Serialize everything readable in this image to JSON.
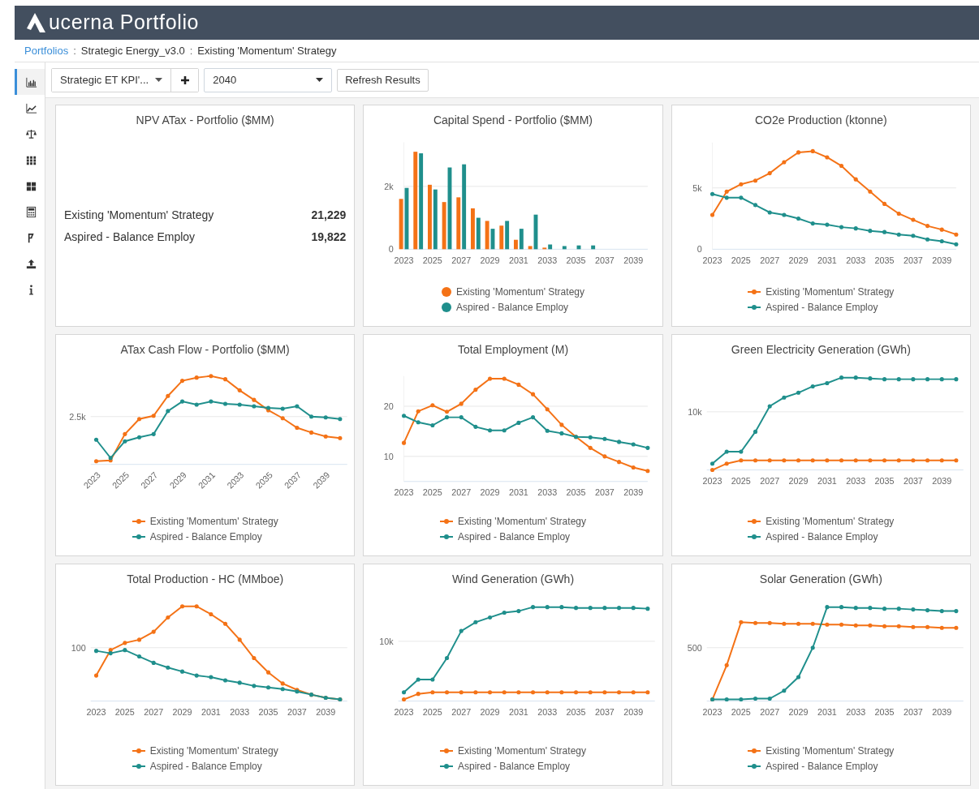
{
  "header": {
    "title": "ucerna Portfolio"
  },
  "breadcrumb": [
    {
      "label": "Portfolios",
      "kind": "link"
    },
    {
      "label": ":",
      "kind": "separator"
    },
    {
      "label": "Strategic Energy_v3.0",
      "kind": "text"
    },
    {
      "label": ":",
      "kind": "separator"
    },
    {
      "label": "Existing 'Momentum' Strategy",
      "kind": "text"
    }
  ],
  "sidebar": {
    "items": [
      {
        "selected": true
      },
      {
        "selected": false
      },
      {
        "selected": false
      },
      {
        "selected": false
      },
      {
        "selected": false
      },
      {
        "selected": false
      },
      {
        "selected": false
      },
      {
        "selected": false
      },
      {
        "selected": false
      }
    ]
  },
  "toolbar": {
    "view_select": {
      "value": "Strategic ET KPI'..."
    },
    "year_select": {
      "value": "2040"
    },
    "refresh_button": {
      "label": "Refresh Results"
    }
  },
  "cards": [
    {
      "kind": "kpi",
      "title": "NPV ATax - Portfolio ($MM)",
      "rows": [
        {
          "label": "Existing 'Momentum' Strategy",
          "value": "21,229"
        },
        {
          "label": "Aspired - Balance Employ",
          "value": "19,822"
        }
      ]
    },
    {
      "kind": "chart",
      "title": "Capital Spend - Portfolio ($MM)",
      "chart_data": {
        "type": "bar",
        "x": [
          2023,
          2024,
          2025,
          2026,
          2027,
          2028,
          2029,
          2030,
          2031,
          2032,
          2033,
          2034,
          2035,
          2036,
          2037,
          2038,
          2039,
          2040
        ],
        "xticks": [
          2023,
          2025,
          2027,
          2029,
          2031,
          2033,
          2035,
          2037,
          2039
        ],
        "yticks": [
          0,
          {
            "value": 2000,
            "label": "2k"
          }
        ],
        "xlim": [
          2023,
          2040
        ],
        "ylim": [
          0,
          3400
        ],
        "series": [
          {
            "name": "Existing 'Momentum' Strategy",
            "color": "#f47216",
            "values": [
              1600,
              3100,
              2050,
              1500,
              1650,
              1300,
              900,
              750,
              300,
              100,
              50,
              0,
              0,
              0,
              0,
              0,
              0,
              0
            ]
          },
          {
            "name": "Aspired - Balance Employ",
            "color": "#1f8f8c",
            "values": [
              1950,
              3050,
              1900,
              2600,
              2700,
              1000,
              650,
              900,
              650,
              1100,
              150,
              100,
              120,
              120,
              0,
              0,
              0,
              0
            ]
          }
        ]
      }
    },
    {
      "kind": "chart",
      "title": "CO2e Production (ktonne)",
      "chart_data": {
        "type": "line",
        "x": [
          2023,
          2024,
          2025,
          2026,
          2027,
          2028,
          2029,
          2030,
          2031,
          2032,
          2033,
          2034,
          2035,
          2036,
          2037,
          2038,
          2039,
          2040
        ],
        "xticks": [
          2023,
          2025,
          2027,
          2029,
          2031,
          2033,
          2035,
          2037,
          2039
        ],
        "yticks": [
          0,
          {
            "value": 5000,
            "label": "5k"
          }
        ],
        "xlim": [
          2023,
          2040
        ],
        "ylim": [
          0,
          8700
        ],
        "series": [
          {
            "name": "Existing 'Momentum' Strategy",
            "color": "#f47216",
            "values": [
              2800,
              4700,
              5300,
              5600,
              6200,
              7100,
              7900,
              8000,
              7500,
              6800,
              5700,
              4700,
              3700,
              2900,
              2400,
              1900,
              1600,
              1200
            ]
          },
          {
            "name": "Aspired - Balance Employ",
            "color": "#1f8f8c",
            "values": [
              4500,
              4200,
              4200,
              3600,
              3000,
              2800,
              2500,
              2100,
              2000,
              1800,
              1700,
              1500,
              1400,
              1200,
              1100,
              800,
              650,
              400
            ]
          }
        ]
      }
    },
    {
      "kind": "line_picture",
      "title": "ATax Cash Flow - Portfolio ($MM)",
      "y_tick": "2.5k",
      "x_labels_rotated": true,
      "x_labels": [
        "2023",
        "2025",
        "2027",
        "2029",
        "2031",
        "2033",
        "2035",
        "2037",
        "2039"
      ],
      "legend": [
        {
          "label": "Existing 'Momentum' Strategy",
          "color": "#f47216"
        },
        {
          "label": "Aspired - Balance Employ",
          "color": "#1f8f8c"
        }
      ]
    },
    {
      "kind": "chart",
      "title": "Total Employment (M)",
      "chart_data": {
        "type": "line",
        "x": [
          2023,
          2024,
          2025,
          2026,
          2027,
          2028,
          2029,
          2030,
          2031,
          2032,
          2033,
          2034,
          2035,
          2036,
          2037,
          2038,
          2039,
          2040
        ],
        "xticks": [
          2023,
          2025,
          2027,
          2029,
          2031,
          2033,
          2035,
          2037,
          2039
        ],
        "yticks": [
          10,
          20
        ],
        "xlim": [
          2023,
          2040
        ],
        "ylim": [
          5,
          26
        ],
        "series": [
          {
            "name": "Existing 'Momentum' Strategy",
            "color": "#f47216",
            "values": [
              12.7,
              19.0,
              20.2,
              18.9,
              20.5,
              23.3,
              25.5,
              25.5,
              24.3,
              22.4,
              19.4,
              16.3,
              13.9,
              11.7,
              10.0,
              8.9,
              7.8,
              7.1
            ]
          },
          {
            "name": "Aspired - Balance Employ",
            "color": "#1f8f8c",
            "values": [
              18.1,
              16.8,
              16.2,
              17.8,
              17.8,
              15.9,
              15.2,
              15.2,
              16.7,
              17.8,
              15.1,
              14.6,
              13.9,
              13.8,
              13.5,
              12.9,
              12.4,
              11.7
            ]
          }
        ]
      }
    },
    {
      "kind": "line_picture",
      "title": "Green Electricity Generation (GWh)",
      "y_tick": "10k",
      "x_labels_rotated": false,
      "x_labels": [
        "2023",
        "2025",
        "2027",
        "2029",
        "2031",
        "2033",
        "2035",
        "2037",
        "2039"
      ],
      "legend": [
        {
          "label": "Existing 'Momentum' Strategy",
          "color": "#f47216"
        },
        {
          "label": "Aspired - Balance Employ",
          "color": "#1f8f8c"
        }
      ]
    },
    {
      "kind": "line_picture",
      "title": "Total Production - HC (MMboe)",
      "y_tick": "100",
      "x_labels_rotated": false,
      "x_labels": [
        "2023",
        "2025",
        "2027",
        "2029",
        "2031",
        "2033",
        "2035",
        "2037",
        "2039"
      ],
      "legend": [
        {
          "label": "Existing 'Momentum' Strategy",
          "color": "#f47216"
        },
        {
          "label": "Aspired - Balance Employ",
          "color": "#1f8f8c"
        }
      ]
    },
    {
      "kind": "line_picture",
      "title": "Wind Generation (GWh)",
      "y_tick": "10k",
      "x_labels_rotated": false,
      "x_labels": [
        "2023",
        "2025",
        "2027",
        "2029",
        "2031",
        "2033",
        "2035",
        "2037",
        "2039"
      ],
      "legend": [
        {
          "label": "Existing 'Momentum' Strategy",
          "color": "#f47216"
        },
        {
          "label": "Aspired - Balance Employ",
          "color": "#1f8f8c"
        }
      ]
    },
    {
      "kind": "line_picture",
      "title": "Solar Generation (GWh)",
      "y_tick": "500",
      "x_labels_rotated": false,
      "x_labels": [
        "2023",
        "2025",
        "2027",
        "2029",
        "2031",
        "2033",
        "2035",
        "2037",
        "2039"
      ],
      "legend": [
        {
          "label": "Existing 'Momentum' Strategy",
          "color": "#f47216"
        },
        {
          "label": "Aspired - Balance Employ",
          "color": "#1f8f8c"
        }
      ]
    }
  ]
}
